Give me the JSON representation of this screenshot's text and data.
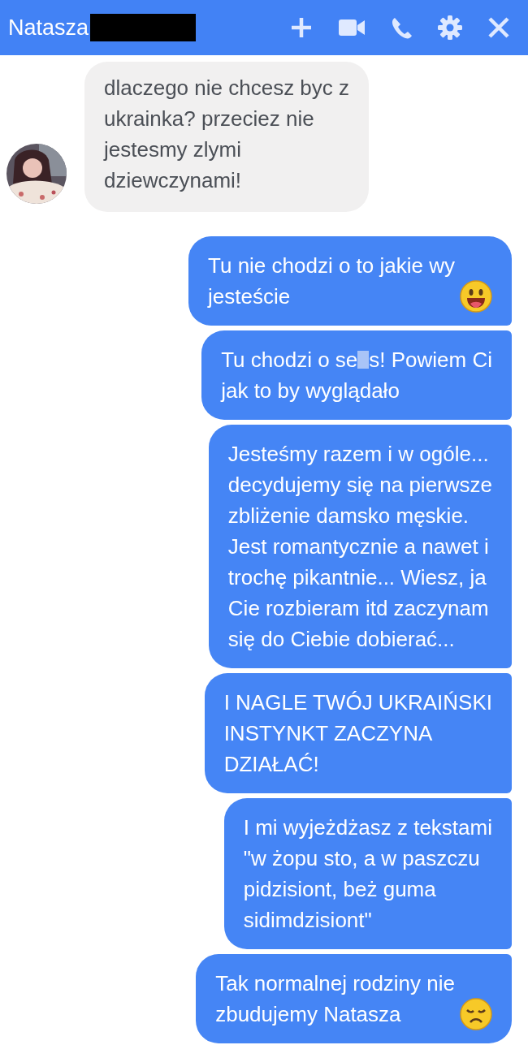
{
  "header": {
    "title": "Natasza",
    "name_redacted": true,
    "actions": [
      {
        "kind": "plus"
      },
      {
        "kind": "video"
      },
      {
        "kind": "phone"
      },
      {
        "kind": "settings"
      },
      {
        "kind": "close"
      }
    ]
  },
  "messages": [
    {
      "kind": "incoming",
      "text": "dlaczego nie chcesz byc z\nukrainka? przeciez nie\njestesmy zlymi\ndziewczynami!"
    },
    {
      "kind": "outgoing",
      "text": "Tu nie chodzi o to jakie wy\njesteście",
      "emoji": {
        "kind": "smile"
      }
    },
    {
      "kind": "outgoing",
      "text": "Tu chodzi o se",
      "censored": true,
      "text_after_censor": "s! Powiem Ci\njak to by wyglądało"
    },
    {
      "kind": "outgoing",
      "text": "Jesteśmy razem i w ogóle...\ndecydujemy się na pierwsze\nzbliżenie damsko męskie.\nJest romantycznie a nawet i\ntrochę pikantnie... Wiesz, ja\nCie rozbieram itd zaczynam\nsię do Ciebie dobierać..."
    },
    {
      "kind": "outgoing",
      "text": "I NAGLE TWÓJ UKRAIŃSKI\nINSTYNKT ZACZYNA\nDZIAŁAĆ!"
    },
    {
      "kind": "outgoing",
      "text": "I mi wyjeżdżasz z tekstami\n\"w żopu sto, a w paszczu\npidzisiont, beż guma\nsidimdzisiont\""
    },
    {
      "kind": "outgoing",
      "text": "Tak normalnej rodziny nie\nzbudujemy Natasza",
      "emoji": {
        "kind": "sad"
      }
    }
  ]
}
